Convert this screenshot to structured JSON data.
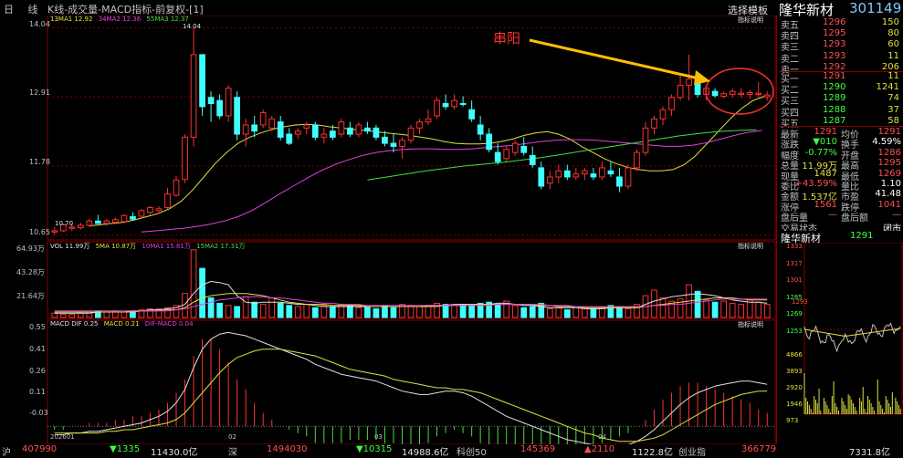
{
  "header": {
    "tabs": "日 线",
    "title": "K线-成交量-MACD指标-前复权-[1]",
    "template_button": "选择模板",
    "stock_name": "隆华新材",
    "stock_code": "301149"
  },
  "price_chart": {
    "legend": {
      "ma13": "13MA1 12.92",
      "ma34": "34MA2 12.36",
      "ma55": "55MA3 12.37"
    },
    "explain": "指标说明",
    "y_labels": [
      "14.04",
      "12.91",
      "11.78",
      "10.65"
    ],
    "high_label": "14.04",
    "low_label": "10.70",
    "annotation": "串阳",
    "colors": {
      "up": "#ff3030",
      "down": "#40ffff",
      "ma13": "#e0e040",
      "ma34": "#e040e0",
      "ma55": "#40e040"
    },
    "candles": [
      [
        10.72,
        10.78,
        10.65,
        10.7,
        1
      ],
      [
        10.72,
        10.84,
        10.7,
        10.82,
        1
      ],
      [
        10.76,
        10.84,
        10.72,
        10.78,
        1
      ],
      [
        10.77,
        10.85,
        10.74,
        10.81,
        1
      ],
      [
        10.81,
        10.92,
        10.78,
        10.88,
        1
      ],
      [
        10.88,
        10.98,
        10.85,
        10.84,
        -1
      ],
      [
        10.84,
        10.92,
        10.8,
        10.88,
        1
      ],
      [
        10.86,
        10.94,
        10.83,
        10.9,
        1
      ],
      [
        10.87,
        10.99,
        10.84,
        10.97,
        1
      ],
      [
        10.95,
        11.02,
        10.88,
        10.91,
        -1
      ],
      [
        10.96,
        11.08,
        10.94,
        11.05,
        1
      ],
      [
        11.02,
        11.12,
        10.98,
        11.1,
        1
      ],
      [
        11.05,
        11.12,
        11.0,
        11.08,
        1
      ],
      [
        11.1,
        11.42,
        11.08,
        11.32,
        1
      ],
      [
        11.3,
        11.62,
        11.28,
        11.55,
        1
      ],
      [
        11.56,
        12.3,
        11.5,
        12.25,
        1
      ],
      [
        12.25,
        14.04,
        12.1,
        13.6,
        1
      ],
      [
        13.6,
        13.6,
        12.6,
        12.75,
        -1
      ],
      [
        12.8,
        13.0,
        12.5,
        12.9,
        -1
      ],
      [
        12.85,
        12.95,
        12.55,
        12.6,
        -1
      ],
      [
        12.6,
        13.1,
        12.5,
        13.05,
        1
      ],
      [
        12.9,
        13.0,
        12.2,
        12.3,
        -1
      ],
      [
        12.3,
        12.55,
        12.1,
        12.45,
        1
      ],
      [
        12.45,
        12.6,
        12.25,
        12.35,
        -1
      ],
      [
        12.45,
        12.7,
        12.4,
        12.65,
        1
      ],
      [
        12.4,
        12.6,
        12.35,
        12.55,
        1
      ],
      [
        12.5,
        12.6,
        12.2,
        12.25,
        -1
      ],
      [
        12.3,
        12.4,
        12.12,
        12.15,
        -1
      ],
      [
        12.3,
        12.4,
        12.22,
        12.35,
        1
      ],
      [
        12.4,
        12.5,
        12.3,
        12.45,
        1
      ],
      [
        12.45,
        12.5,
        12.2,
        12.25,
        -1
      ],
      [
        12.25,
        12.4,
        12.15,
        12.3,
        1
      ],
      [
        12.35,
        12.45,
        12.2,
        12.25,
        -1
      ],
      [
        12.3,
        12.55,
        12.25,
        12.5,
        1
      ],
      [
        12.4,
        12.5,
        12.25,
        12.3,
        -1
      ],
      [
        12.3,
        12.5,
        12.25,
        12.45,
        1
      ],
      [
        12.4,
        12.5,
        12.3,
        12.35,
        -1
      ],
      [
        12.4,
        12.45,
        12.2,
        12.25,
        -1
      ],
      [
        12.25,
        12.35,
        12.1,
        12.15,
        -1
      ],
      [
        12.15,
        12.3,
        12.0,
        12.1,
        -1
      ],
      [
        12.1,
        12.25,
        11.9,
        12.2,
        1
      ],
      [
        12.2,
        12.45,
        12.15,
        12.4,
        1
      ],
      [
        12.4,
        12.55,
        12.3,
        12.5,
        1
      ],
      [
        12.5,
        12.7,
        12.45,
        12.55,
        1
      ],
      [
        12.6,
        12.9,
        12.55,
        12.85,
        1
      ],
      [
        12.8,
        12.95,
        12.7,
        12.75,
        -1
      ],
      [
        12.75,
        12.95,
        12.7,
        12.85,
        1
      ],
      [
        12.8,
        12.92,
        12.75,
        12.8,
        -1
      ],
      [
        12.7,
        12.85,
        12.5,
        12.55,
        -1
      ],
      [
        12.45,
        12.6,
        12.2,
        12.3,
        -1
      ],
      [
        12.3,
        12.4,
        12.0,
        12.05,
        -1
      ],
      [
        12.0,
        12.15,
        11.8,
        11.85,
        -1
      ],
      [
        11.9,
        12.1,
        11.85,
        12.05,
        1
      ],
      [
        12.0,
        12.2,
        11.95,
        12.15,
        1
      ],
      [
        12.1,
        12.25,
        11.95,
        12.0,
        -1
      ],
      [
        11.95,
        12.1,
        11.75,
        11.8,
        -1
      ],
      [
        11.75,
        11.85,
        11.4,
        11.45,
        -1
      ],
      [
        11.5,
        11.7,
        11.4,
        11.6,
        1
      ],
      [
        11.6,
        11.8,
        11.5,
        11.7,
        1
      ],
      [
        11.7,
        11.8,
        11.55,
        11.6,
        -1
      ],
      [
        11.6,
        11.75,
        11.55,
        11.65,
        1
      ],
      [
        11.65,
        11.75,
        11.55,
        11.7,
        1
      ],
      [
        11.65,
        11.75,
        11.55,
        11.6,
        -1
      ],
      [
        11.6,
        11.85,
        11.55,
        11.75,
        1
      ],
      [
        11.7,
        11.85,
        11.6,
        11.65,
        -1
      ],
      [
        11.6,
        11.75,
        11.35,
        11.45,
        -1
      ],
      [
        11.45,
        11.8,
        11.4,
        11.75,
        1
      ],
      [
        11.75,
        12.05,
        11.7,
        12.0,
        1
      ],
      [
        12.0,
        12.5,
        11.95,
        12.4,
        1
      ],
      [
        12.4,
        12.6,
        12.3,
        12.55,
        1
      ],
      [
        12.55,
        12.75,
        12.45,
        12.7,
        1
      ],
      [
        12.7,
        12.95,
        12.6,
        12.9,
        1
      ],
      [
        12.9,
        13.3,
        12.85,
        13.1,
        1
      ],
      [
        13.1,
        13.6,
        12.85,
        13.2,
        1
      ],
      [
        13.2,
        13.3,
        12.9,
        12.95,
        -1
      ],
      [
        12.95,
        13.1,
        12.85,
        13.05,
        1
      ],
      [
        13.0,
        13.05,
        12.9,
        12.93,
        -1
      ],
      [
        12.92,
        13.0,
        12.88,
        12.96,
        1
      ],
      [
        12.95,
        13.05,
        12.9,
        13.0,
        1
      ],
      [
        12.97,
        13.05,
        12.9,
        12.95,
        1
      ],
      [
        12.95,
        13.02,
        12.88,
        12.98,
        1
      ],
      [
        12.97,
        13.15,
        12.9,
        12.95,
        1
      ],
      [
        12.94,
        13.0,
        12.85,
        12.91,
        1
      ]
    ],
    "ma13": [
      10.8,
      10.82,
      10.84,
      10.86,
      10.9,
      10.95,
      11.0,
      11.08,
      11.2,
      11.38,
      11.6,
      11.82,
      12.0,
      12.15,
      12.25,
      12.32,
      12.38,
      12.42,
      12.45,
      12.46,
      12.45,
      12.42,
      12.4,
      12.38,
      12.36,
      12.34,
      12.32,
      12.3,
      12.28,
      12.25,
      12.22,
      12.18,
      12.15,
      12.14,
      12.14,
      12.15,
      12.18,
      12.22,
      12.28,
      12.32,
      12.34,
      12.3,
      12.22,
      12.1,
      12.0,
      11.9,
      11.82,
      11.76,
      11.72,
      11.7,
      11.7,
      11.72,
      11.8,
      11.95,
      12.15,
      12.35,
      12.55,
      12.72,
      12.85,
      12.92
    ],
    "ma34": [
      10.7,
      10.72,
      10.74,
      10.76,
      10.79,
      10.83,
      10.88,
      10.95,
      11.05,
      11.18,
      11.32,
      11.45,
      11.58,
      11.7,
      11.8,
      11.88,
      11.95,
      12.0,
      12.03,
      12.05,
      12.06,
      12.06,
      12.05,
      12.05,
      12.06,
      12.08,
      12.1,
      12.12,
      12.15,
      12.18,
      12.2,
      12.21,
      12.21,
      12.2,
      12.18,
      12.16,
      12.14,
      12.12,
      12.1,
      12.1,
      12.12,
      12.16,
      12.22,
      12.28,
      12.33,
      12.36
    ],
    "ma55": [
      11.55,
      11.6,
      11.65,
      11.7,
      11.74,
      11.78,
      11.81,
      11.84,
      11.88,
      11.92,
      11.97,
      12.02,
      12.07,
      12.12,
      12.17,
      12.22,
      12.27,
      12.31,
      12.34,
      12.36,
      12.37
    ]
  },
  "volume_chart": {
    "legend": {
      "vol": "VOL 11.99万",
      "ma5": "5MA 10.87万",
      "ma10": "10MA1 15.81万",
      "ma15": "15MA2 17.31万"
    },
    "explain": "指标说明",
    "y_labels": [
      "64.93万",
      "43.28万",
      "21.64万"
    ],
    "volumes": [
      4,
      3,
      3,
      4,
      5,
      6,
      5,
      6,
      5,
      6,
      7,
      8,
      8,
      9,
      11,
      22,
      62,
      45,
      18,
      13,
      11,
      10,
      19,
      14,
      12,
      18,
      13,
      11,
      10,
      12,
      9,
      11,
      10,
      12,
      11,
      9,
      10,
      8,
      11,
      9,
      12,
      11,
      10,
      11,
      13,
      12,
      11,
      12,
      11,
      13,
      14,
      12,
      15,
      11,
      9,
      10,
      13,
      8,
      9,
      7,
      10,
      9,
      8,
      9,
      11,
      10,
      8,
      12,
      20,
      25,
      18,
      15,
      17,
      30,
      24,
      16,
      14,
      15,
      13,
      12,
      16,
      14,
      12
    ],
    "ma5": [
      4,
      4,
      4,
      4,
      4,
      5,
      5,
      5,
      5,
      6,
      6,
      7,
      7,
      8,
      9,
      12,
      22,
      30,
      33,
      32,
      30,
      20,
      14,
      13,
      14,
      14,
      14,
      13,
      12,
      12,
      11,
      10,
      10,
      10,
      10,
      10,
      10,
      10,
      10,
      10,
      10,
      10,
      10,
      11,
      11,
      11,
      12,
      12,
      12,
      12,
      12,
      13,
      13,
      12,
      11,
      11,
      10,
      9,
      9,
      9,
      9,
      8,
      8,
      8,
      9,
      9,
      9,
      9,
      12,
      15,
      17,
      19,
      20,
      21,
      22,
      21,
      20,
      18,
      16,
      15,
      14,
      14,
      13
    ],
    "ma10": [
      5,
      5,
      5,
      5,
      5,
      5,
      5,
      5,
      5,
      5,
      6,
      6,
      6,
      7,
      7,
      9,
      14,
      18,
      20,
      21,
      22,
      22,
      22,
      21,
      20,
      18,
      16,
      14,
      13,
      12,
      12,
      12,
      11,
      11,
      11,
      11,
      10,
      10,
      10,
      10,
      10,
      10,
      10,
      10,
      10,
      11,
      11,
      11,
      11,
      12,
      12,
      12,
      12,
      12,
      12,
      12,
      11,
      11,
      10,
      10,
      10,
      9,
      9,
      9,
      9,
      9,
      9,
      9,
      10,
      11,
      12,
      13,
      14,
      15,
      16,
      17,
      18,
      18,
      18,
      17,
      16,
      16,
      16
    ],
    "ma15": [
      6,
      6,
      6,
      6,
      6,
      6,
      6,
      6,
      6,
      6,
      6,
      6,
      6,
      6,
      7,
      8,
      10,
      12,
      14,
      16,
      17,
      18,
      19,
      19,
      19,
      18,
      18,
      17,
      16,
      15,
      14,
      13,
      13,
      12,
      12,
      12,
      11,
      11,
      11,
      11,
      11,
      11,
      11,
      11,
      11,
      11,
      11,
      11,
      11,
      11,
      11,
      12,
      12,
      12,
      12,
      12,
      12,
      11,
      11,
      11,
      10,
      10,
      10,
      10,
      10,
      10,
      10,
      10,
      10,
      11,
      11,
      12,
      12,
      13,
      14,
      15,
      16,
      17,
      17,
      17,
      17,
      17,
      17
    ]
  },
  "macd_chart": {
    "legend": {
      "dif": "MACD DIF 0.25",
      "dea": "MACD 0.21",
      "hist": "DIF-MACD 0.04"
    },
    "explain": "指标说明",
    "y_labels": [
      "0.55",
      "0.41",
      "0.26",
      "0.11",
      "-0.03"
    ],
    "x_labels": [
      "202601",
      "02",
      "03",
      "04"
    ],
    "dif": [
      -0.05,
      -0.05,
      -0.04,
      -0.04,
      -0.03,
      -0.03,
      -0.02,
      -0.01,
      0.0,
      0.01,
      0.02,
      0.04,
      0.06,
      0.09,
      0.14,
      0.22,
      0.35,
      0.46,
      0.52,
      0.55,
      0.56,
      0.55,
      0.54,
      0.52,
      0.5,
      0.48,
      0.46,
      0.44,
      0.42,
      0.4,
      0.37,
      0.35,
      0.33,
      0.31,
      0.3,
      0.29,
      0.28,
      0.27,
      0.25,
      0.23,
      0.21,
      0.2,
      0.19,
      0.19,
      0.2,
      0.21,
      0.21,
      0.2,
      0.18,
      0.15,
      0.12,
      0.09,
      0.06,
      0.04,
      0.02,
      0.0,
      -0.02,
      -0.04,
      -0.06,
      -0.08,
      -0.09,
      -0.1,
      -0.11,
      -0.12,
      -0.12,
      -0.12,
      -0.11,
      -0.09,
      -0.06,
      -0.02,
      0.03,
      0.08,
      0.13,
      0.17,
      0.2,
      0.22,
      0.24,
      0.25,
      0.26,
      0.27,
      0.27,
      0.26,
      0.25
    ],
    "dea": [
      -0.04,
      -0.04,
      -0.04,
      -0.04,
      -0.04,
      -0.04,
      -0.03,
      -0.03,
      -0.02,
      -0.02,
      -0.01,
      0.0,
      0.01,
      0.02,
      0.04,
      0.08,
      0.14,
      0.2,
      0.26,
      0.32,
      0.37,
      0.41,
      0.43,
      0.45,
      0.46,
      0.46,
      0.46,
      0.45,
      0.44,
      0.43,
      0.42,
      0.4,
      0.38,
      0.36,
      0.34,
      0.33,
      0.32,
      0.31,
      0.3,
      0.28,
      0.27,
      0.26,
      0.25,
      0.24,
      0.23,
      0.23,
      0.22,
      0.22,
      0.21,
      0.2,
      0.18,
      0.16,
      0.14,
      0.12,
      0.1,
      0.08,
      0.06,
      0.04,
      0.02,
      0.0,
      -0.02,
      -0.04,
      -0.05,
      -0.07,
      -0.08,
      -0.09,
      -0.09,
      -0.09,
      -0.08,
      -0.07,
      -0.05,
      -0.02,
      0.01,
      0.04,
      0.07,
      0.1,
      0.13,
      0.15,
      0.17,
      0.19,
      0.2,
      0.21,
      0.21
    ]
  },
  "order_book": {
    "sell": [
      {
        "label": "卖五",
        "price": "1296",
        "vol": "150"
      },
      {
        "label": "卖四",
        "price": "1295",
        "vol": "80"
      },
      {
        "label": "卖三",
        "price": "1293",
        "vol": "60"
      },
      {
        "label": "卖二",
        "price": "1293",
        "vol": "11"
      },
      {
        "label": "卖一",
        "price": "1292",
        "vol": "206"
      }
    ],
    "buy": [
      {
        "label": "买一",
        "price": "1291",
        "vol": "11"
      },
      {
        "label": "买二",
        "price": "1290",
        "vol": "1241"
      },
      {
        "label": "买三",
        "price": "1289",
        "vol": "74"
      },
      {
        "label": "买四",
        "price": "1288",
        "vol": "37"
      },
      {
        "label": "买五",
        "price": "1287",
        "vol": "58"
      }
    ]
  },
  "stats": [
    {
      "l1": "最新",
      "v1": "1291",
      "l2": "均价",
      "v2": "1291"
    },
    {
      "l1": "涨跌",
      "v1": "▼010",
      "l2": "换手",
      "v2": "4.59%"
    },
    {
      "l1": "幅度",
      "v1": "-0.77%",
      "l2": "开盘",
      "v2": "1286"
    },
    {
      "l1": "总量",
      "v1": "11.99万",
      "l2": "最高",
      "v2": "1295"
    },
    {
      "l1": "现量",
      "v1": "1487",
      "l2": "最低",
      "v2": "1269"
    },
    {
      "l1": "委比",
      "v1": "+43.59%",
      "l2": "量比",
      "v2": "1.10"
    },
    {
      "l1": "金额",
      "v1": "1.537亿",
      "l2": "市盈",
      "v2": "41.48"
    },
    {
      "l1": "涨停",
      "v1": "1561",
      "l2": "跌停",
      "v2": "1041"
    },
    {
      "l1": "盘后量",
      "v1": "—",
      "l2": "盘后额",
      "v2": "—"
    },
    {
      "l1": "交易状态",
      "v1": "",
      "l2": "",
      "v2": "闭市"
    }
  ],
  "mini": {
    "name": "隆华新材",
    "price": "1291",
    "price_labels": [
      "1333",
      "1317",
      "1301",
      "1285",
      "1269",
      "1253"
    ],
    "price_mid": "1293",
    "vol_labels": [
      "4866",
      "3893",
      "2920",
      "1946",
      "973"
    ]
  },
  "bottom_bar": {
    "label1": "沪",
    "v1": "407990",
    "c1": "▼1335",
    "d1": "11430.0亿",
    "label2": "深",
    "v2": "1494030",
    "c2": "▼10315",
    "d2": "14988.6亿",
    "label3": "科创50",
    "v3": "145369",
    "c3": "▲2110",
    "d3": "1122.8亿",
    "label4": "创业指",
    "v4": "366779",
    "c4": "",
    "d4": "7331.8亿"
  }
}
